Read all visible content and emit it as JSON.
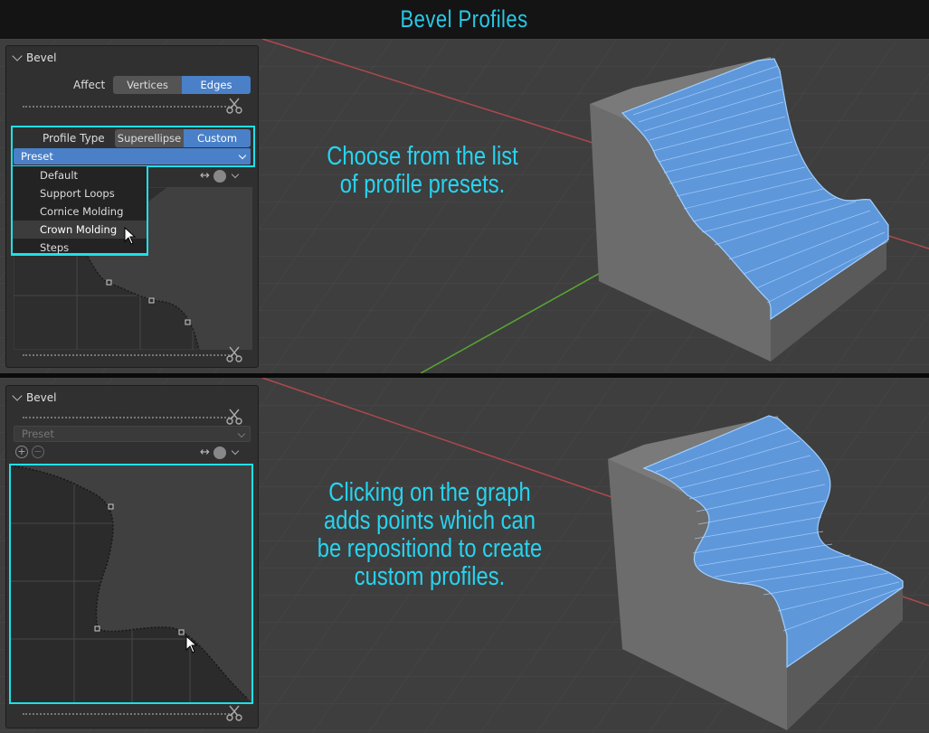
{
  "title": "Bevel Profiles",
  "top": {
    "panel_title": "Bevel",
    "affect": {
      "label": "Affect",
      "options": [
        "Vertices",
        "Edges"
      ],
      "selected": "Edges"
    },
    "profile_type": {
      "label": "Profile Type",
      "options": [
        "Superellipse",
        "Custom"
      ],
      "selected": "Custom"
    },
    "preset": {
      "label": "Preset"
    },
    "preset_menu": [
      "Default",
      "Support Loops",
      "Cornice Molding",
      "Crown Molding",
      "Steps"
    ],
    "hovered_item": "Crown Molding",
    "caption": [
      "Choose from the list",
      "of profile presets."
    ]
  },
  "bottom": {
    "panel_title": "Bevel",
    "preset": {
      "label": "Preset"
    },
    "caption": [
      "Clicking on the graph",
      "adds points which can",
      "be repositiond to create",
      "custom profiles."
    ]
  },
  "icons": [
    "chevron-down-icon",
    "scissors-icon",
    "zoom-in-icon",
    "zoom-out-icon",
    "flip-icon",
    "record-icon",
    "mouse-cursor-icon"
  ],
  "colors": {
    "accent": "#4a80c8",
    "highlight": "#1ee0e8",
    "caption": "#27d4f0",
    "model_face": "#6fa4e0"
  }
}
